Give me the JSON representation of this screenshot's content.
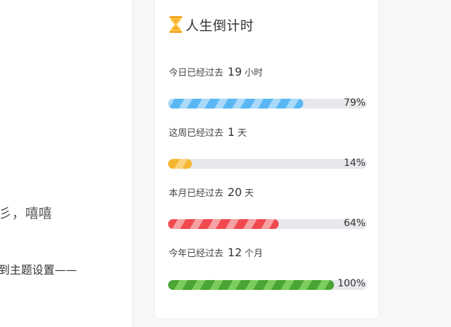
{
  "background_text": {
    "frag_1": "彡，嘻嘻",
    "frag_2": "到主题设置——"
  },
  "card": {
    "icon": "hourglass-icon",
    "title": "人生倒计时"
  },
  "rows": [
    {
      "prefix": "今日已经过去",
      "value": "19",
      "unit": "小时",
      "percent_label": "79%",
      "percent": 0.68,
      "color": "#5ab7f4",
      "stripe": "#a9daf9"
    },
    {
      "prefix": "这周已经过去",
      "value": "1",
      "unit": "天",
      "percent_label": "14%",
      "percent": 0.12,
      "color": "#f6b531",
      "stripe": "#fbd37c"
    },
    {
      "prefix": "本月已经过去",
      "value": "20",
      "unit": "天",
      "percent_label": "64%",
      "percent": 0.555,
      "color": "#f04a4f",
      "stripe": "#f7a1a4"
    },
    {
      "prefix": "今年已经过去",
      "value": "12",
      "unit": "个月",
      "percent_label": "100%",
      "percent": 0.835,
      "color": "#4aa534",
      "stripe": "#7ccd5c"
    }
  ]
}
